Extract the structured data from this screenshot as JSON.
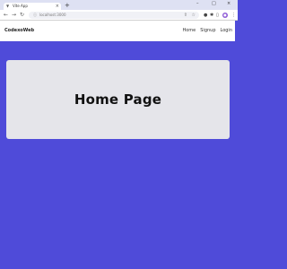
{
  "browser": {
    "tab_title": "Vite App",
    "tab_close": "×",
    "new_tab": "+",
    "url": "localhost:3000",
    "controls": {
      "minimize": "–",
      "restore": "□",
      "close": "×"
    }
  },
  "site": {
    "brand": "CodexoWeb",
    "nav": [
      "Home",
      "Signup",
      "Login"
    ]
  },
  "hero": {
    "title": "Home Page"
  },
  "colors": {
    "page_background": "#4f4bd9",
    "card_background": "#e5e5ea",
    "header_background": "#ffffff"
  }
}
